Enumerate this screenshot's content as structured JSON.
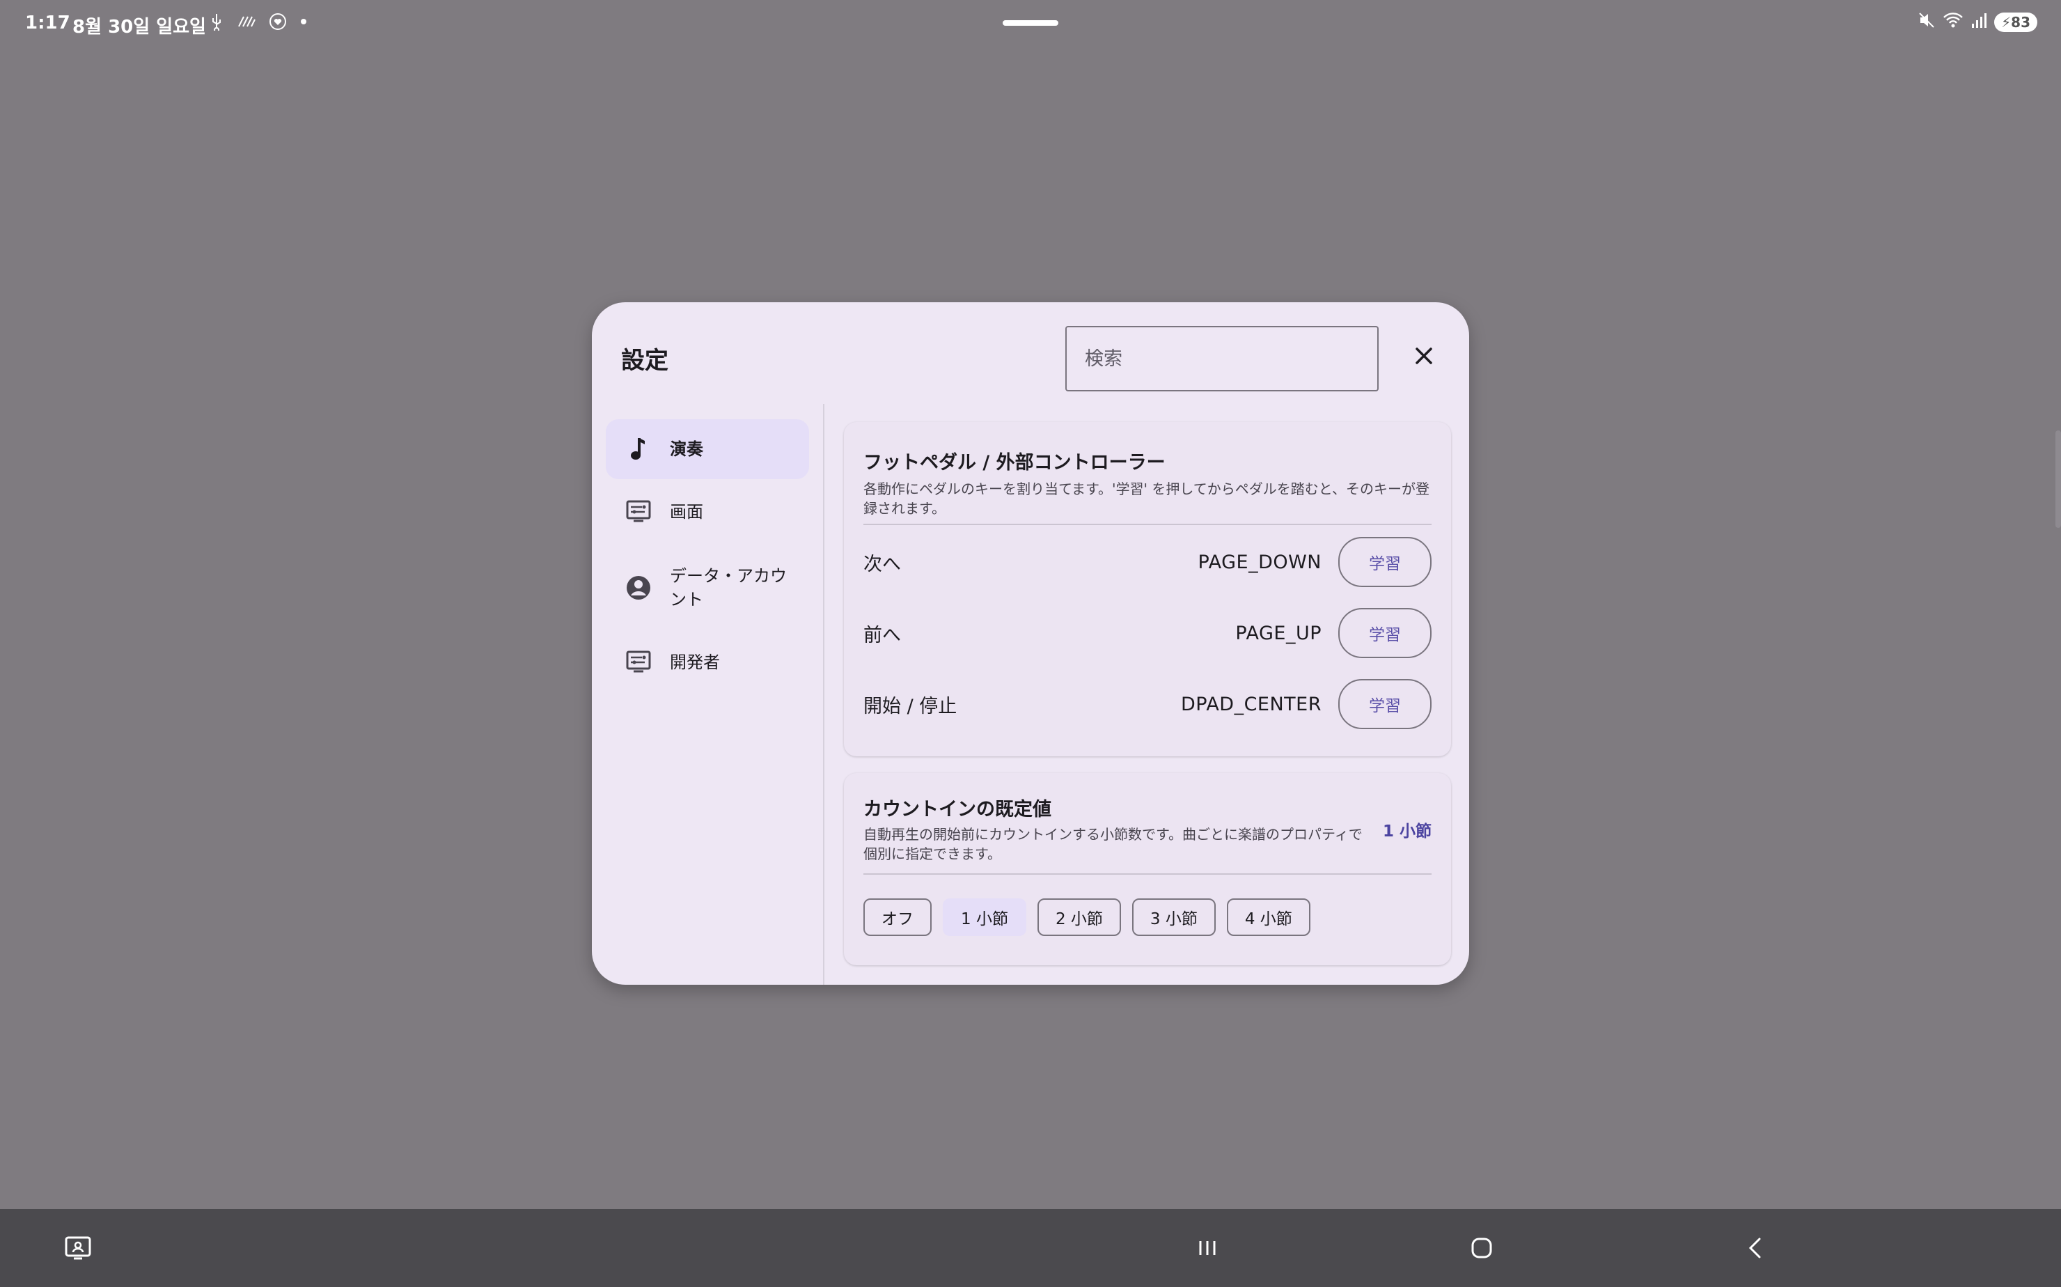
{
  "status_bar": {
    "time": "1:17",
    "date": "8월 30일 일요일",
    "left_icons": [
      "usb-icon",
      "data-saver-icon",
      "heart-icon",
      "dot-icon"
    ],
    "right_icons": [
      "mute-icon",
      "wifi-icon",
      "signal-icon"
    ],
    "battery": "83"
  },
  "dialog": {
    "title": "設定",
    "search_placeholder": "検索",
    "close_icon": "close-icon"
  },
  "nav": {
    "items": [
      {
        "label": "演奏",
        "icon": "music-note-icon",
        "active": true
      },
      {
        "label": "画面",
        "icon": "display-settings-icon",
        "active": false
      },
      {
        "label": "データ・アカウント",
        "icon": "account-circle-icon",
        "active": false
      },
      {
        "label": "開発者",
        "icon": "developer-settings-icon",
        "active": false
      }
    ]
  },
  "foot_pedal": {
    "title": "フットペダル / 外部コントローラー",
    "description": "各動作にペダルのキーを割り当てます。'学習' を押してからペダルを踏むと、そのキーが登録されます。",
    "rows": [
      {
        "label": "次へ",
        "key": "PAGE_DOWN",
        "button": "学習"
      },
      {
        "label": "前へ",
        "key": "PAGE_UP",
        "button": "学習"
      },
      {
        "label": "開始 / 停止",
        "key": "DPAD_CENTER",
        "button": "学習"
      }
    ]
  },
  "count_in": {
    "title": "カウントインの既定値",
    "description": "自動再生の開始前にカウントインする小節数です。曲ごとに楽譜のプロパティで個別に指定できます。",
    "current_value": "1 小節",
    "options": [
      "オフ",
      "1 小節",
      "2 小節",
      "3 小節",
      "4 小節"
    ],
    "selected_index": 1
  },
  "bottom_bar": {
    "icons": [
      "screenshot-icon",
      "recents-icon",
      "home-icon",
      "back-icon"
    ]
  }
}
